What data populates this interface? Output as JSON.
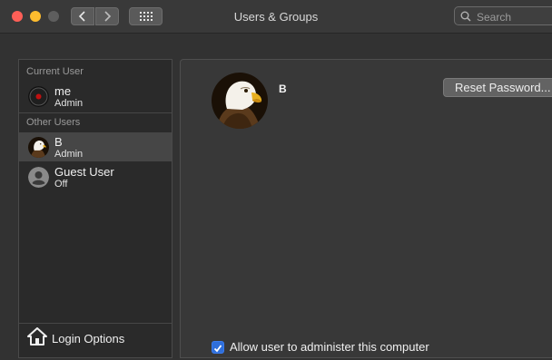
{
  "window": {
    "title": "Users & Groups"
  },
  "toolbar": {
    "back_icon": "chevron-left-icon",
    "forward_icon": "chevron-right-icon",
    "grid_icon": "grid-icon"
  },
  "search": {
    "placeholder": "Search",
    "value": ""
  },
  "sidebar": {
    "current_user_label": "Current User",
    "current_user": {
      "name": "me",
      "role": "Admin"
    },
    "other_users_label": "Other Users",
    "other_users": [
      {
        "name": "B",
        "role": "Admin",
        "selected": true
      },
      {
        "name": "Guest User",
        "role": "Off",
        "selected": false
      }
    ],
    "login_options_label": "Login Options"
  },
  "main": {
    "user_name": "B",
    "reset_password_label": "Reset Password...",
    "admin_checkbox_label": "Allow user to administer this computer",
    "admin_checked": true
  },
  "colors": {
    "accent": "#2f6fdb",
    "close": "#fe5f57",
    "minimize": "#febc2e"
  }
}
